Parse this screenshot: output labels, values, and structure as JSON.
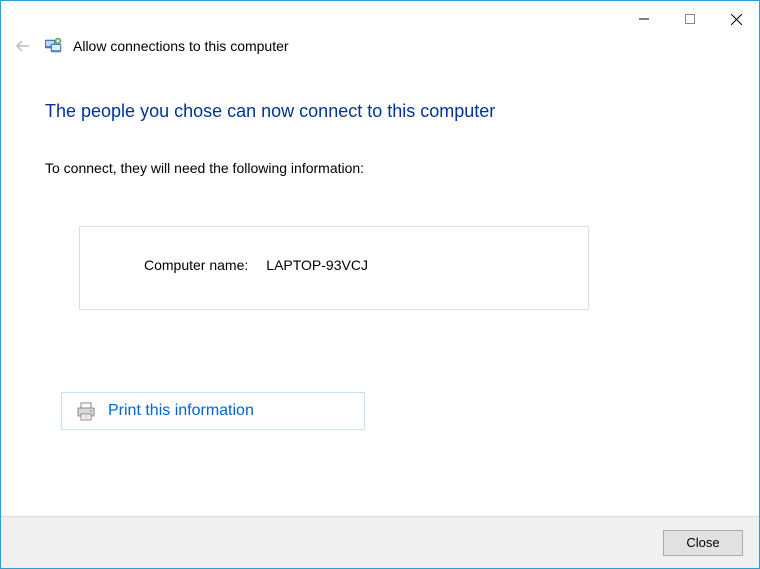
{
  "header": {
    "title": "Allow connections to this computer"
  },
  "main": {
    "heading": "The people you chose can now connect to this computer",
    "subtext": "To connect, they will need the following information:",
    "info": {
      "label": "Computer name:",
      "value": "LAPTOP-93VCJ"
    },
    "print_label": "Print this information"
  },
  "footer": {
    "close_label": "Close"
  }
}
